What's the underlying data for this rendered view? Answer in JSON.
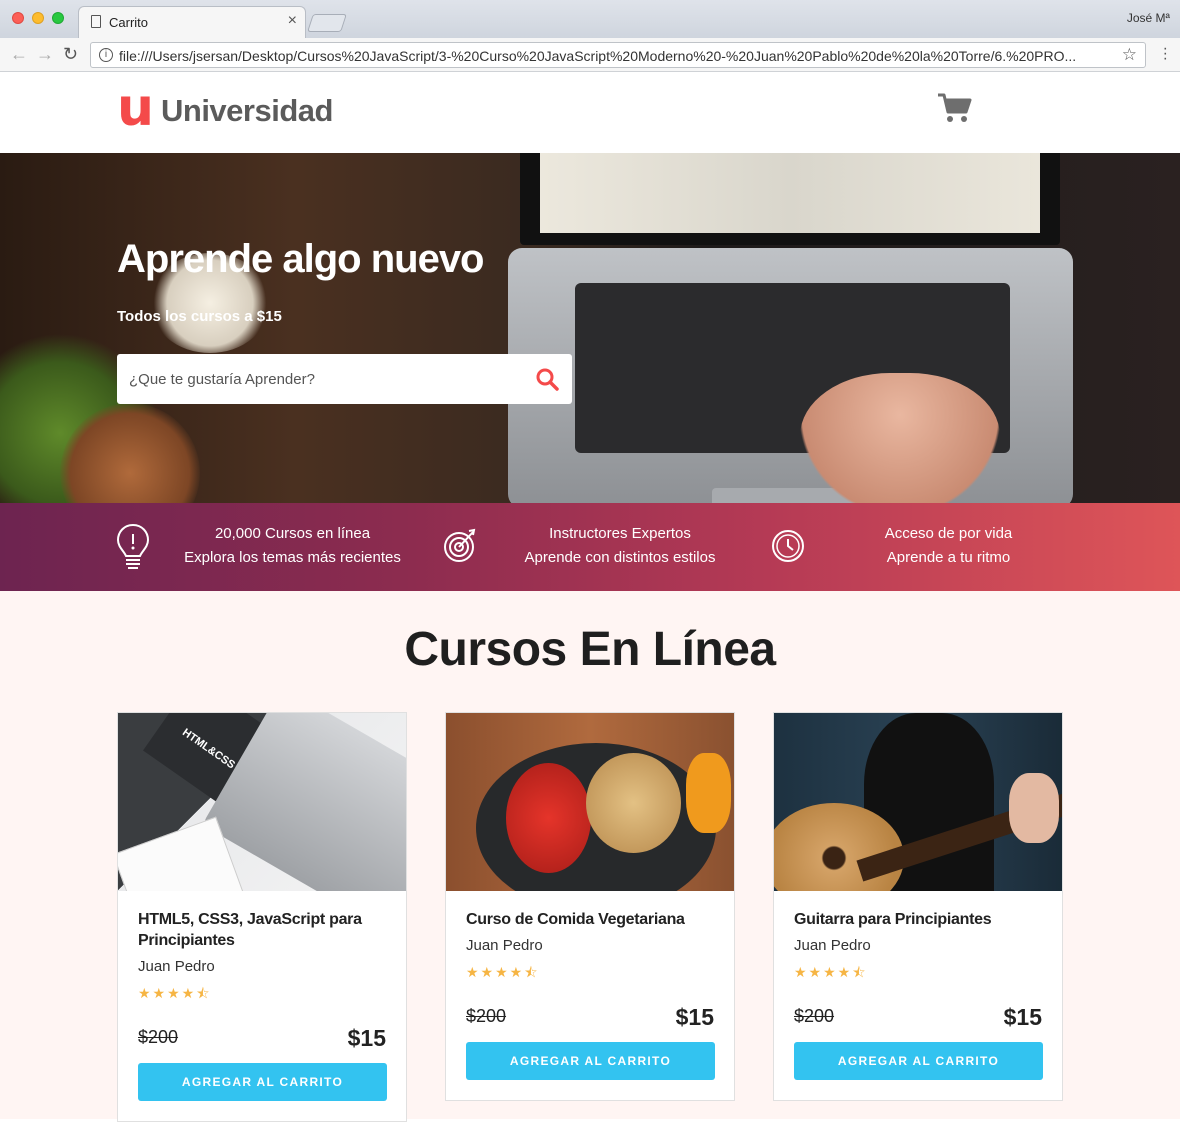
{
  "browser": {
    "tab_title": "Carrito",
    "tab_close": "×",
    "profile_name": "José Mª",
    "address": "file:///Users/jsersan/Desktop/Cursos%20JavaScript/3-%20Curso%20JavaScript%20Moderno%20-%20Juan%20Pablo%20de%20la%20Torre/6.%20PRO...",
    "back": "←",
    "forward": "→",
    "reload": "↻",
    "info": "i",
    "star": "☆"
  },
  "header": {
    "logo_mark": "u",
    "logo_text": "Universidad",
    "cart_icon": "cart-icon"
  },
  "hero": {
    "title": "Aprende algo nuevo",
    "subtitle": "Todos los cursos a $15",
    "search_placeholder": "¿Que te gustaría Aprender?"
  },
  "features": [
    {
      "icon": "lightbulb-icon",
      "line1": "20,000 Cursos en línea",
      "line2": "Explora los temas más recientes"
    },
    {
      "icon": "target-icon",
      "line1": "Instructores Expertos",
      "line2": "Aprende con distintos estilos"
    },
    {
      "icon": "clock-icon",
      "line1": "Acceso de por vida",
      "line2": "Aprende a tu ritmo"
    }
  ],
  "courses_section": {
    "title": "Cursos En Línea"
  },
  "courses": [
    {
      "title": "HTML5, CSS3, JavaScript para Principiantes",
      "author": "Juan Pedro",
      "rating": 4.5,
      "stars": "★★★★⯪",
      "old_price": "$200",
      "price": "$15",
      "button": "AGREGAR AL CARRITO",
      "img_label": "HTML&CSS"
    },
    {
      "title": "Curso de Comida Vegetariana",
      "author": "Juan Pedro",
      "rating": 4.5,
      "stars": "★★★★⯪",
      "old_price": "$200",
      "price": "$15",
      "button": "AGREGAR AL CARRITO"
    },
    {
      "title": "Guitarra para Principiantes",
      "author": "Juan Pedro",
      "rating": 4.5,
      "stars": "★★★★⯪",
      "old_price": "$200",
      "price": "$15",
      "button": "AGREGAR AL CARRITO"
    }
  ],
  "colors": {
    "brand_red": "#f44a4a",
    "button_blue": "#33c3f0",
    "star_gold": "#f6b544",
    "bar_start": "#6d2450",
    "bar_end": "#de5558"
  }
}
